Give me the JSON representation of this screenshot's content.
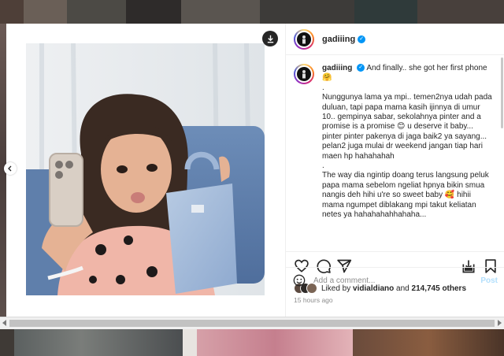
{
  "post": {
    "username": "gadiiing",
    "verified_mark": "✓",
    "caption": {
      "username": "gadiiing",
      "lines": [
        "And finally.. she got her first phone 🤗",
        ".",
        "Nunggunya lama ya mpi.. temen2nya udah pada duluan, tapi papa mama kasih ijinnya di umur 10.. gempinya sabar, sekolahnya pinter and a promise is a promise 😊 u deserve it baby... pinter pinter pakenya di jaga baik2 ya sayang... pelan2 juga mulai dr weekend jangan tiap hari maen hp hahahahah",
        ".",
        "The way dia ngintip doang terus langsung peluk papa mama sebelom ngeliat hpnya bikin smua nangis deh hihi u're so sweet baby 🥰 hihii mama ngumpet diblakang mpi takut keliatan netes ya hahahahahhahaha..."
      ]
    },
    "liked_by_prefix": "Liked by",
    "liked_by_user": "vidialdiano",
    "liked_and": "and",
    "likes_count": "214,745 others",
    "timestamp": "15 hours ago",
    "comment_placeholder": "Add a comment...",
    "post_label": "Post"
  },
  "icons": {
    "download": "download-icon",
    "like": "heart-icon",
    "comment": "comment-icon",
    "share": "share-icon",
    "save": "bookmark-icon",
    "emoji": "emoji-icon",
    "prev": "chevron-left-icon"
  },
  "colors": {
    "accent": "#0095f6",
    "post_disabled": "#b2dffc",
    "secondary_text": "#8e8e8e"
  }
}
